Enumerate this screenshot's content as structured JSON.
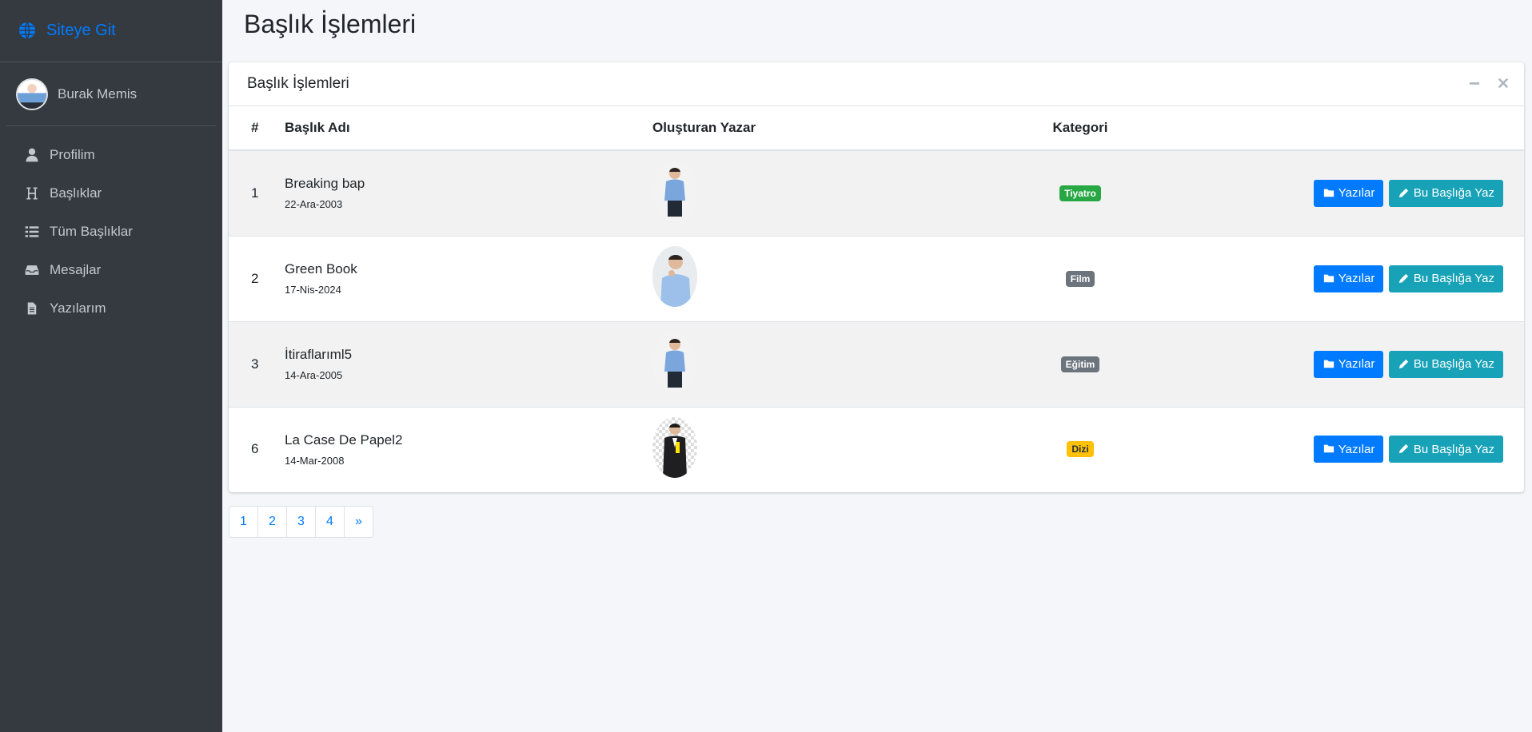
{
  "brand": {
    "label": "Siteye Git",
    "icon": "globe-icon",
    "color": "#007bff"
  },
  "user": {
    "name": "Burak Memis"
  },
  "sidebar": {
    "items": [
      {
        "label": "Profilim",
        "icon": "user-icon"
      },
      {
        "label": "Başlıklar",
        "icon": "heading-icon"
      },
      {
        "label": "Tüm Başlıklar",
        "icon": "list-icon"
      },
      {
        "label": "Mesajlar",
        "icon": "inbox-icon"
      },
      {
        "label": "Yazılarım",
        "icon": "file-icon"
      }
    ]
  },
  "page": {
    "title": "Başlık İşlemleri"
  },
  "card": {
    "title": "Başlık İşlemleri",
    "columns": [
      "#",
      "Başlık Adı",
      "Oluşturan Yazar",
      "Kategori"
    ],
    "rows": [
      {
        "num": "1",
        "title": "Breaking bap",
        "date": "22-Ara-2003",
        "category": "Tiyatro",
        "category_color": "#28a745"
      },
      {
        "num": "2",
        "title": "Green Book",
        "date": "17-Nis-2024",
        "category": "Film",
        "category_color": "#6c757d"
      },
      {
        "num": "3",
        "title": "İtiraflarıml5",
        "date": "14-Ara-2005",
        "category": "Eğitim",
        "category_color": "#6c757d"
      },
      {
        "num": "6",
        "title": "La Case De Papel2",
        "date": "14-Mar-2008",
        "category": "Dizi",
        "category_color": "#ffc107"
      }
    ],
    "actions": {
      "posts_label": "Yazılar",
      "write_label": "Bu Başlığa Yaz"
    }
  },
  "pagination": {
    "pages": [
      "1",
      "2",
      "3",
      "4",
      "»"
    ]
  }
}
